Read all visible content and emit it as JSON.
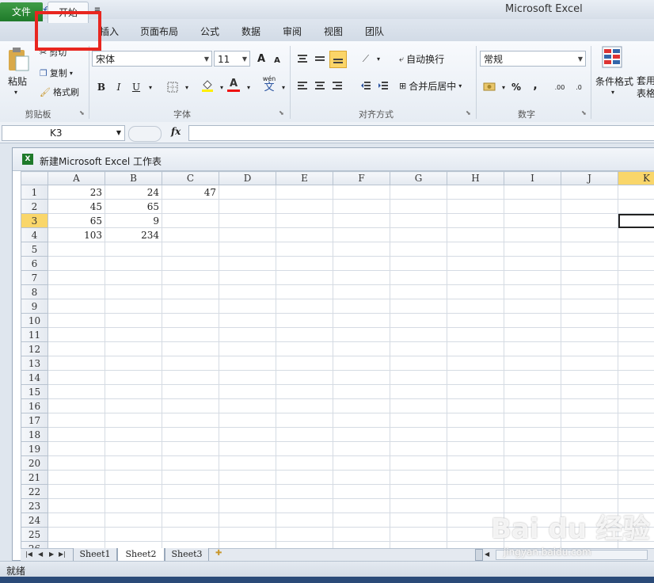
{
  "app": {
    "title": "Microsoft Excel"
  },
  "tabs": [
    "文件",
    "开始",
    "插入",
    "页面布局",
    "公式",
    "数据",
    "审阅",
    "视图",
    "团队"
  ],
  "ribbon": {
    "clipboard": {
      "label": "剪贴板",
      "paste": "粘贴",
      "cut": "剪切",
      "copy": "复制",
      "format_painter": "格式刷"
    },
    "font": {
      "label": "字体",
      "font_name": "宋体",
      "font_size": "11",
      "grow": "A",
      "shrink": "A",
      "bold": "B",
      "italic": "I",
      "underline": "U",
      "wen": "wén",
      "wen_char": "文",
      "font_color_glyph": "A"
    },
    "alignment": {
      "label": "对齐方式",
      "wrap_text": "自动换行",
      "merge_center": "合并后居中"
    },
    "number": {
      "label": "数字",
      "format": "常规",
      "percent": "%",
      "comma": ",",
      "inc_dec": ".00",
      "dec_dec": ".0"
    },
    "styles": {
      "conditional_format": "条件格式",
      "table_format": "套用\n表格"
    }
  },
  "formula_bar": {
    "name_box": "K3",
    "fx": "fx",
    "value": ""
  },
  "workbook": {
    "title": "新建Microsoft Excel 工作表",
    "columns": [
      "A",
      "B",
      "C",
      "D",
      "E",
      "F",
      "G",
      "H",
      "I",
      "J",
      "K"
    ],
    "selected_column": "K",
    "selected_row": 3,
    "rows": [
      [
        "23",
        "24",
        "47",
        "",
        "",
        "",
        "",
        "",
        "",
        "",
        ""
      ],
      [
        "45",
        "65",
        "",
        "",
        "",
        "",
        "",
        "",
        "",
        "",
        ""
      ],
      [
        "65",
        "9",
        "",
        "",
        "",
        "",
        "",
        "",
        "",
        "",
        ""
      ],
      [
        "103",
        "234",
        "",
        "",
        "",
        "",
        "",
        "",
        "",
        "",
        ""
      ],
      [
        "",
        "",
        "",
        "",
        "",
        "",
        "",
        "",
        "",
        "",
        ""
      ],
      [
        "",
        "",
        "",
        "",
        "",
        "",
        "",
        "",
        "",
        "",
        ""
      ],
      [
        "",
        "",
        "",
        "",
        "",
        "",
        "",
        "",
        "",
        "",
        ""
      ],
      [
        "",
        "",
        "",
        "",
        "",
        "",
        "",
        "",
        "",
        "",
        ""
      ],
      [
        "",
        "",
        "",
        "",
        "",
        "",
        "",
        "",
        "",
        "",
        ""
      ],
      [
        "",
        "",
        "",
        "",
        "",
        "",
        "",
        "",
        "",
        "",
        ""
      ],
      [
        "",
        "",
        "",
        "",
        "",
        "",
        "",
        "",
        "",
        "",
        ""
      ],
      [
        "",
        "",
        "",
        "",
        "",
        "",
        "",
        "",
        "",
        "",
        ""
      ],
      [
        "",
        "",
        "",
        "",
        "",
        "",
        "",
        "",
        "",
        "",
        ""
      ],
      [
        "",
        "",
        "",
        "",
        "",
        "",
        "",
        "",
        "",
        "",
        ""
      ],
      [
        "",
        "",
        "",
        "",
        "",
        "",
        "",
        "",
        "",
        "",
        ""
      ],
      [
        "",
        "",
        "",
        "",
        "",
        "",
        "",
        "",
        "",
        "",
        ""
      ],
      [
        "",
        "",
        "",
        "",
        "",
        "",
        "",
        "",
        "",
        "",
        ""
      ],
      [
        "",
        "",
        "",
        "",
        "",
        "",
        "",
        "",
        "",
        "",
        ""
      ],
      [
        "",
        "",
        "",
        "",
        "",
        "",
        "",
        "",
        "",
        "",
        ""
      ],
      [
        "",
        "",
        "",
        "",
        "",
        "",
        "",
        "",
        "",
        "",
        ""
      ],
      [
        "",
        "",
        "",
        "",
        "",
        "",
        "",
        "",
        "",
        "",
        ""
      ],
      [
        "",
        "",
        "",
        "",
        "",
        "",
        "",
        "",
        "",
        "",
        ""
      ],
      [
        "",
        "",
        "",
        "",
        "",
        "",
        "",
        "",
        "",
        "",
        ""
      ],
      [
        "",
        "",
        "",
        "",
        "",
        "",
        "",
        "",
        "",
        "",
        ""
      ],
      [
        "",
        "",
        "",
        "",
        "",
        "",
        "",
        "",
        "",
        "",
        ""
      ],
      [
        "",
        "",
        "",
        "",
        "",
        "",
        "",
        "",
        "",
        "",
        ""
      ]
    ],
    "sheets": [
      "Sheet1",
      "Sheet2",
      "Sheet3"
    ],
    "active_sheet": "Sheet2"
  },
  "status": {
    "text": "就绪"
  },
  "watermark": {
    "main": "Bai du 经验",
    "sub": "jingyan.baidu.com"
  },
  "colors": {
    "file_tab": "#2a8a35",
    "highlight": "#e8261f",
    "selected_header": "#f9d66a"
  }
}
